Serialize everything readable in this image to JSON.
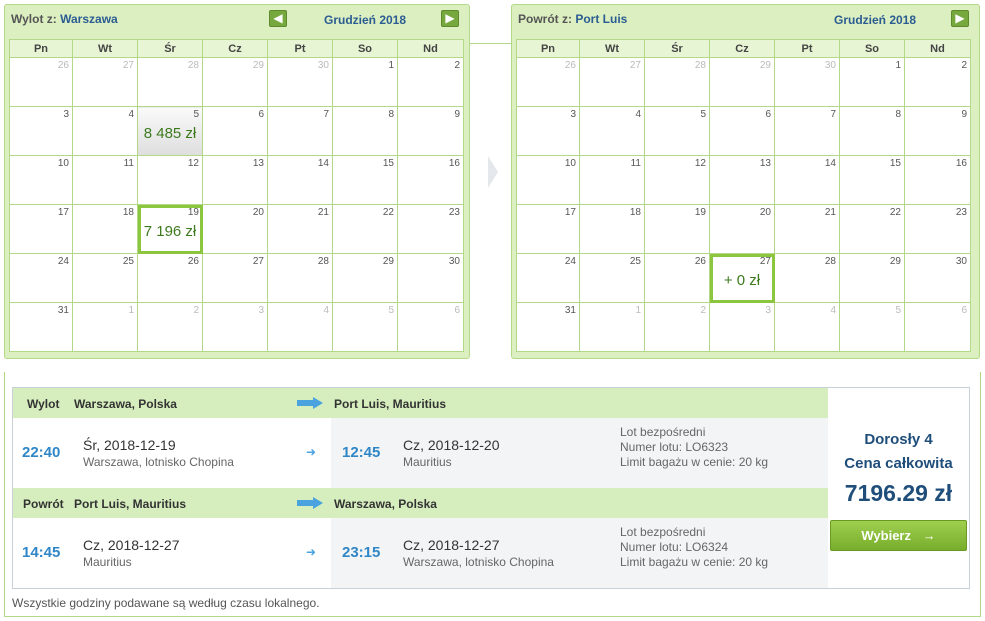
{
  "outbound_calendar": {
    "label": "Wylot z:",
    "city": "Warszawa",
    "month": "Grudzień 2018",
    "prev_icon": "arrow-left-icon",
    "next_icon": "arrow-right-icon",
    "weekdays": [
      "Pn",
      "Wt",
      "Śr",
      "Cz",
      "Pt",
      "So",
      "Nd"
    ],
    "weeks": [
      [
        {
          "d": "26",
          "o": true
        },
        {
          "d": "27",
          "o": true
        },
        {
          "d": "28",
          "o": true
        },
        {
          "d": "29",
          "o": true
        },
        {
          "d": "30",
          "o": true
        },
        {
          "d": "1"
        },
        {
          "d": "2"
        }
      ],
      [
        {
          "d": "3"
        },
        {
          "d": "4"
        },
        {
          "d": "5",
          "price": "8 485 zł"
        },
        {
          "d": "6"
        },
        {
          "d": "7"
        },
        {
          "d": "8"
        },
        {
          "d": "9"
        }
      ],
      [
        {
          "d": "10"
        },
        {
          "d": "11"
        },
        {
          "d": "12"
        },
        {
          "d": "13"
        },
        {
          "d": "14"
        },
        {
          "d": "15"
        },
        {
          "d": "16"
        }
      ],
      [
        {
          "d": "17"
        },
        {
          "d": "18"
        },
        {
          "d": "19",
          "price": "7 196 zł",
          "sel": true
        },
        {
          "d": "20"
        },
        {
          "d": "21"
        },
        {
          "d": "22"
        },
        {
          "d": "23"
        }
      ],
      [
        {
          "d": "24"
        },
        {
          "d": "25"
        },
        {
          "d": "26"
        },
        {
          "d": "27"
        },
        {
          "d": "28"
        },
        {
          "d": "29"
        },
        {
          "d": "30"
        }
      ],
      [
        {
          "d": "31"
        },
        {
          "d": "1",
          "o": true
        },
        {
          "d": "2",
          "o": true
        },
        {
          "d": "3",
          "o": true
        },
        {
          "d": "4",
          "o": true
        },
        {
          "d": "5",
          "o": true
        },
        {
          "d": "6",
          "o": true
        }
      ]
    ]
  },
  "return_calendar": {
    "label": "Powrót z:",
    "city": "Port Luis",
    "month": "Grudzień 2018",
    "next_icon": "arrow-right-icon",
    "weekdays": [
      "Pn",
      "Wt",
      "Śr",
      "Cz",
      "Pt",
      "So",
      "Nd"
    ],
    "weeks": [
      [
        {
          "d": "26",
          "o": true
        },
        {
          "d": "27",
          "o": true
        },
        {
          "d": "28",
          "o": true
        },
        {
          "d": "29",
          "o": true
        },
        {
          "d": "30",
          "o": true
        },
        {
          "d": "1"
        },
        {
          "d": "2"
        }
      ],
      [
        {
          "d": "3"
        },
        {
          "d": "4"
        },
        {
          "d": "5"
        },
        {
          "d": "6"
        },
        {
          "d": "7"
        },
        {
          "d": "8"
        },
        {
          "d": "9"
        }
      ],
      [
        {
          "d": "10"
        },
        {
          "d": "11"
        },
        {
          "d": "12"
        },
        {
          "d": "13"
        },
        {
          "d": "14"
        },
        {
          "d": "15"
        },
        {
          "d": "16"
        }
      ],
      [
        {
          "d": "17"
        },
        {
          "d": "18"
        },
        {
          "d": "19"
        },
        {
          "d": "20"
        },
        {
          "d": "21"
        },
        {
          "d": "22"
        },
        {
          "d": "23"
        }
      ],
      [
        {
          "d": "24"
        },
        {
          "d": "25"
        },
        {
          "d": "26"
        },
        {
          "d": "27",
          "price": "+ 0 zł",
          "sel": true
        },
        {
          "d": "28"
        },
        {
          "d": "29"
        },
        {
          "d": "30"
        }
      ],
      [
        {
          "d": "31"
        },
        {
          "d": "1",
          "o": true
        },
        {
          "d": "2",
          "o": true
        },
        {
          "d": "3",
          "o": true
        },
        {
          "d": "4",
          "o": true
        },
        {
          "d": "5",
          "o": true
        },
        {
          "d": "6",
          "o": true
        }
      ]
    ]
  },
  "summary": {
    "outbound": {
      "label": "Wylot",
      "from": "Warszawa, Polska",
      "to": "Port Luis, Mauritius",
      "dep_time": "22:40",
      "dep_date": "Śr, 2018-12-19",
      "dep_airport": "Warszawa, lotnisko Chopina",
      "arr_time": "12:45",
      "arr_date": "Cz, 2018-12-20",
      "arr_airport": "Mauritius",
      "direct": "Lot bezpośredni",
      "flight_no": "Numer lotu: LO6323",
      "baggage": "Limit bagażu w cenie: 20 kg"
    },
    "return": {
      "label": "Powrót",
      "from": "Port Luis, Mauritius",
      "to": "Warszawa, Polska",
      "dep_time": "14:45",
      "dep_date": "Cz, 2018-12-27",
      "dep_airport": "Mauritius",
      "arr_time": "23:15",
      "arr_date": "Cz, 2018-12-27",
      "arr_airport": "Warszawa, lotnisko Chopina",
      "direct": "Lot bezpośredni",
      "flight_no": "Numer lotu: LO6324",
      "baggage": "Limit bagażu w cenie: 20 kg"
    },
    "passengers": "Dorosły 4",
    "total_label": "Cena całkowita",
    "total": "7196.29 zł",
    "choose_label": "Wybierz",
    "choose_icon": "→"
  },
  "note": "Wszystkie godziny podawane są według czasu lokalnego.",
  "colors": {
    "accent_green": "#8cc63f",
    "panel_green": "#dcefc0",
    "time_blue": "#2f86c7",
    "price_green": "#3d7a1e"
  }
}
